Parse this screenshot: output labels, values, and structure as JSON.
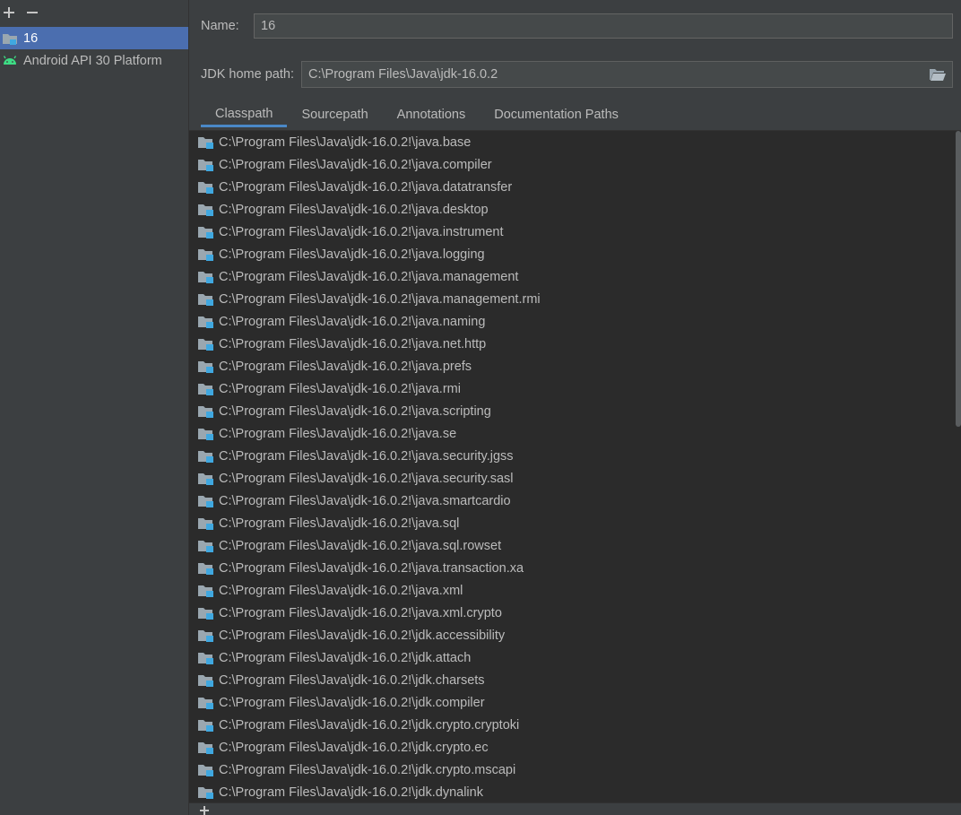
{
  "toolbar": {
    "add_icon": "plus-icon",
    "remove_icon": "minus-icon"
  },
  "sdks": [
    {
      "label": "16",
      "icon": "jdk-folder-icon",
      "selected": true
    },
    {
      "label": "Android API 30 Platform",
      "icon": "android-icon",
      "selected": false
    }
  ],
  "form": {
    "name_label": "Name:",
    "name_value": "16",
    "jdk_home_label": "JDK home path:",
    "jdk_home_value": "C:\\Program Files\\Java\\jdk-16.0.2",
    "browse_icon": "folder-open-icon"
  },
  "tabs": [
    {
      "label": "Classpath",
      "active": true
    },
    {
      "label": "Sourcepath",
      "active": false
    },
    {
      "label": "Annotations",
      "active": false
    },
    {
      "label": "Documentation Paths",
      "active": false
    }
  ],
  "classpath": [
    "C:\\Program Files\\Java\\jdk-16.0.2!\\java.base",
    "C:\\Program Files\\Java\\jdk-16.0.2!\\java.compiler",
    "C:\\Program Files\\Java\\jdk-16.0.2!\\java.datatransfer",
    "C:\\Program Files\\Java\\jdk-16.0.2!\\java.desktop",
    "C:\\Program Files\\Java\\jdk-16.0.2!\\java.instrument",
    "C:\\Program Files\\Java\\jdk-16.0.2!\\java.logging",
    "C:\\Program Files\\Java\\jdk-16.0.2!\\java.management",
    "C:\\Program Files\\Java\\jdk-16.0.2!\\java.management.rmi",
    "C:\\Program Files\\Java\\jdk-16.0.2!\\java.naming",
    "C:\\Program Files\\Java\\jdk-16.0.2!\\java.net.http",
    "C:\\Program Files\\Java\\jdk-16.0.2!\\java.prefs",
    "C:\\Program Files\\Java\\jdk-16.0.2!\\java.rmi",
    "C:\\Program Files\\Java\\jdk-16.0.2!\\java.scripting",
    "C:\\Program Files\\Java\\jdk-16.0.2!\\java.se",
    "C:\\Program Files\\Java\\jdk-16.0.2!\\java.security.jgss",
    "C:\\Program Files\\Java\\jdk-16.0.2!\\java.security.sasl",
    "C:\\Program Files\\Java\\jdk-16.0.2!\\java.smartcardio",
    "C:\\Program Files\\Java\\jdk-16.0.2!\\java.sql",
    "C:\\Program Files\\Java\\jdk-16.0.2!\\java.sql.rowset",
    "C:\\Program Files\\Java\\jdk-16.0.2!\\java.transaction.xa",
    "C:\\Program Files\\Java\\jdk-16.0.2!\\java.xml",
    "C:\\Program Files\\Java\\jdk-16.0.2!\\java.xml.crypto",
    "C:\\Program Files\\Java\\jdk-16.0.2!\\jdk.accessibility",
    "C:\\Program Files\\Java\\jdk-16.0.2!\\jdk.attach",
    "C:\\Program Files\\Java\\jdk-16.0.2!\\jdk.charsets",
    "C:\\Program Files\\Java\\jdk-16.0.2!\\jdk.compiler",
    "C:\\Program Files\\Java\\jdk-16.0.2!\\jdk.crypto.cryptoki",
    "C:\\Program Files\\Java\\jdk-16.0.2!\\jdk.crypto.ec",
    "C:\\Program Files\\Java\\jdk-16.0.2!\\jdk.crypto.mscapi",
    "C:\\Program Files\\Java\\jdk-16.0.2!\\jdk.dynalink"
  ],
  "list_icon": "library-jar-icon",
  "colors": {
    "background": "#3c3f41",
    "list_background": "#2b2b2b",
    "selection": "#4b6eaf",
    "tab_underline": "#4a88c7",
    "android_green": "#3ddc84",
    "icon_blue": "#40a8e0"
  }
}
